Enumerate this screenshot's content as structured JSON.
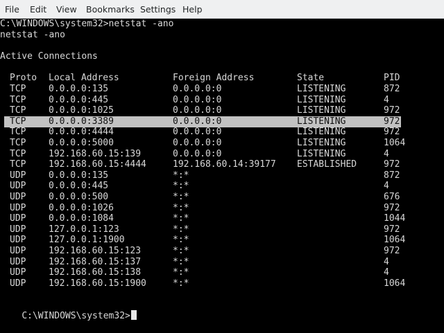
{
  "menu": [
    "File",
    "Edit",
    "View",
    "Bookmarks",
    "Settings",
    "Help"
  ],
  "terminal": {
    "command_line": "C:\\WINDOWS\\system32>netstat -ano",
    "echo_line": "netstat -ano",
    "section_title": "Active Connections",
    "headers": {
      "proto": "Proto",
      "local": "Local Address",
      "foreign": "Foreign Address",
      "state": "State",
      "pid": "PID"
    },
    "rows": [
      {
        "proto": "TCP",
        "local": "0.0.0.0:135",
        "foreign": "0.0.0.0:0",
        "state": "LISTENING",
        "pid": "872"
      },
      {
        "proto": "TCP",
        "local": "0.0.0.0:445",
        "foreign": "0.0.0.0:0",
        "state": "LISTENING",
        "pid": "4"
      },
      {
        "proto": "TCP",
        "local": "0.0.0.0:1025",
        "foreign": "0.0.0.0:0",
        "state": "LISTENING",
        "pid": "972"
      },
      {
        "proto": "TCP",
        "local": "0.0.0.0:3389",
        "foreign": "0.0.0.0:0",
        "state": "LISTENING",
        "pid": "972",
        "selected": true
      },
      {
        "proto": "TCP",
        "local": "0.0.0.0:4444",
        "foreign": "0.0.0.0:0",
        "state": "LISTENING",
        "pid": "972"
      },
      {
        "proto": "TCP",
        "local": "0.0.0.0:5000",
        "foreign": "0.0.0.0:0",
        "state": "LISTENING",
        "pid": "1064"
      },
      {
        "proto": "TCP",
        "local": "192.168.60.15:139",
        "foreign": "0.0.0.0:0",
        "state": "LISTENING",
        "pid": "4"
      },
      {
        "proto": "TCP",
        "local": "192.168.60.15:4444",
        "foreign": "192.168.60.14:39177",
        "state": "ESTABLISHED",
        "pid": "972"
      },
      {
        "proto": "UDP",
        "local": "0.0.0.0:135",
        "foreign": "*:*",
        "state": "",
        "pid": "872"
      },
      {
        "proto": "UDP",
        "local": "0.0.0.0:445",
        "foreign": "*:*",
        "state": "",
        "pid": "4"
      },
      {
        "proto": "UDP",
        "local": "0.0.0.0:500",
        "foreign": "*:*",
        "state": "",
        "pid": "676"
      },
      {
        "proto": "UDP",
        "local": "0.0.0.0:1026",
        "foreign": "*:*",
        "state": "",
        "pid": "972"
      },
      {
        "proto": "UDP",
        "local": "0.0.0.0:1084",
        "foreign": "*:*",
        "state": "",
        "pid": "1044"
      },
      {
        "proto": "UDP",
        "local": "127.0.0.1:123",
        "foreign": "*:*",
        "state": "",
        "pid": "972"
      },
      {
        "proto": "UDP",
        "local": "127.0.0.1:1900",
        "foreign": "*:*",
        "state": "",
        "pid": "1064"
      },
      {
        "proto": "UDP",
        "local": "192.168.60.15:123",
        "foreign": "*:*",
        "state": "",
        "pid": "972"
      },
      {
        "proto": "UDP",
        "local": "192.168.60.15:137",
        "foreign": "*:*",
        "state": "",
        "pid": "4"
      },
      {
        "proto": "UDP",
        "local": "192.168.60.15:138",
        "foreign": "*:*",
        "state": "",
        "pid": "4"
      },
      {
        "proto": "UDP",
        "local": "192.168.60.15:1900",
        "foreign": "*:*",
        "state": "",
        "pid": "1064"
      }
    ],
    "prompt": "C:\\WINDOWS\\system32>"
  },
  "colors": {
    "terminal_bg": "#000000",
    "terminal_fg": "#d8d8d8",
    "selection_bg": "#c2c2c2",
    "menubar_bg": "#eff0f1"
  }
}
